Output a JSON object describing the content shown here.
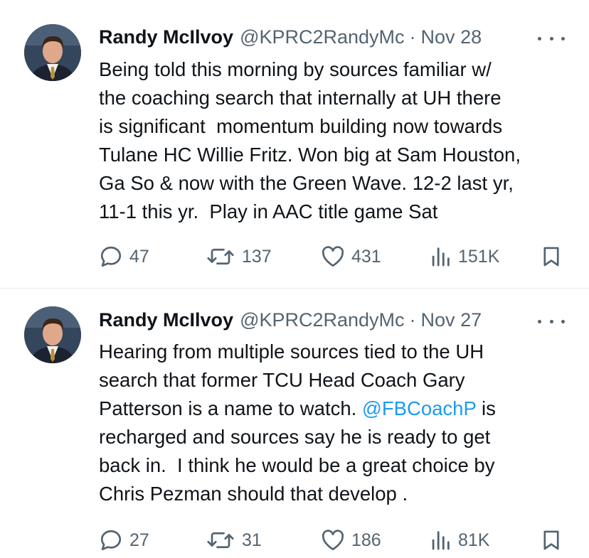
{
  "tweets": [
    {
      "author_name": "Randy McIlvoy",
      "handle": "@KPRC2RandyMc",
      "separator": "·",
      "date": "Nov 28",
      "lines": [
        "Being told this morning by sources familiar w/",
        "the coaching search that internally at UH there",
        "is significant  momentum building now towards",
        "Tulane HC Willie Fritz. Won big at Sam Houston,",
        "Ga So & now with the Green Wave. 12-2 last yr,",
        "11-1 this yr.  Play in AAC title game Sat"
      ],
      "replies": "47",
      "reposts": "137",
      "likes": "431",
      "views": "151K"
    },
    {
      "author_name": "Randy McIlvoy",
      "handle": "@KPRC2RandyMc",
      "separator": "·",
      "date": "Nov 27",
      "lines": [
        "Hearing from multiple sources tied to the UH",
        "search that former TCU Head Coach Gary"
      ],
      "line3_before": "Patterson is a name to watch. ",
      "line3_mention": "@FBCoachP",
      "line3_after": " is",
      "lines_rest": [
        "recharged and sources say he is ready to get",
        "back in.  I think he would be a great choice by",
        "Chris Pezman should that develop ."
      ],
      "replies": "27",
      "reposts": "31",
      "likes": "186",
      "views": "81K"
    }
  ],
  "icons": {
    "reply": "reply-bubble-icon",
    "repost": "repost-arrows-icon",
    "like": "heart-icon",
    "views": "views-bar-chart-icon",
    "bookmark": "bookmark-icon",
    "more": "more-dots-icon"
  },
  "colors": {
    "text": "#0f1419",
    "secondary": "#536471",
    "link": "#1d9bf0",
    "divider": "#e6e9ec"
  }
}
